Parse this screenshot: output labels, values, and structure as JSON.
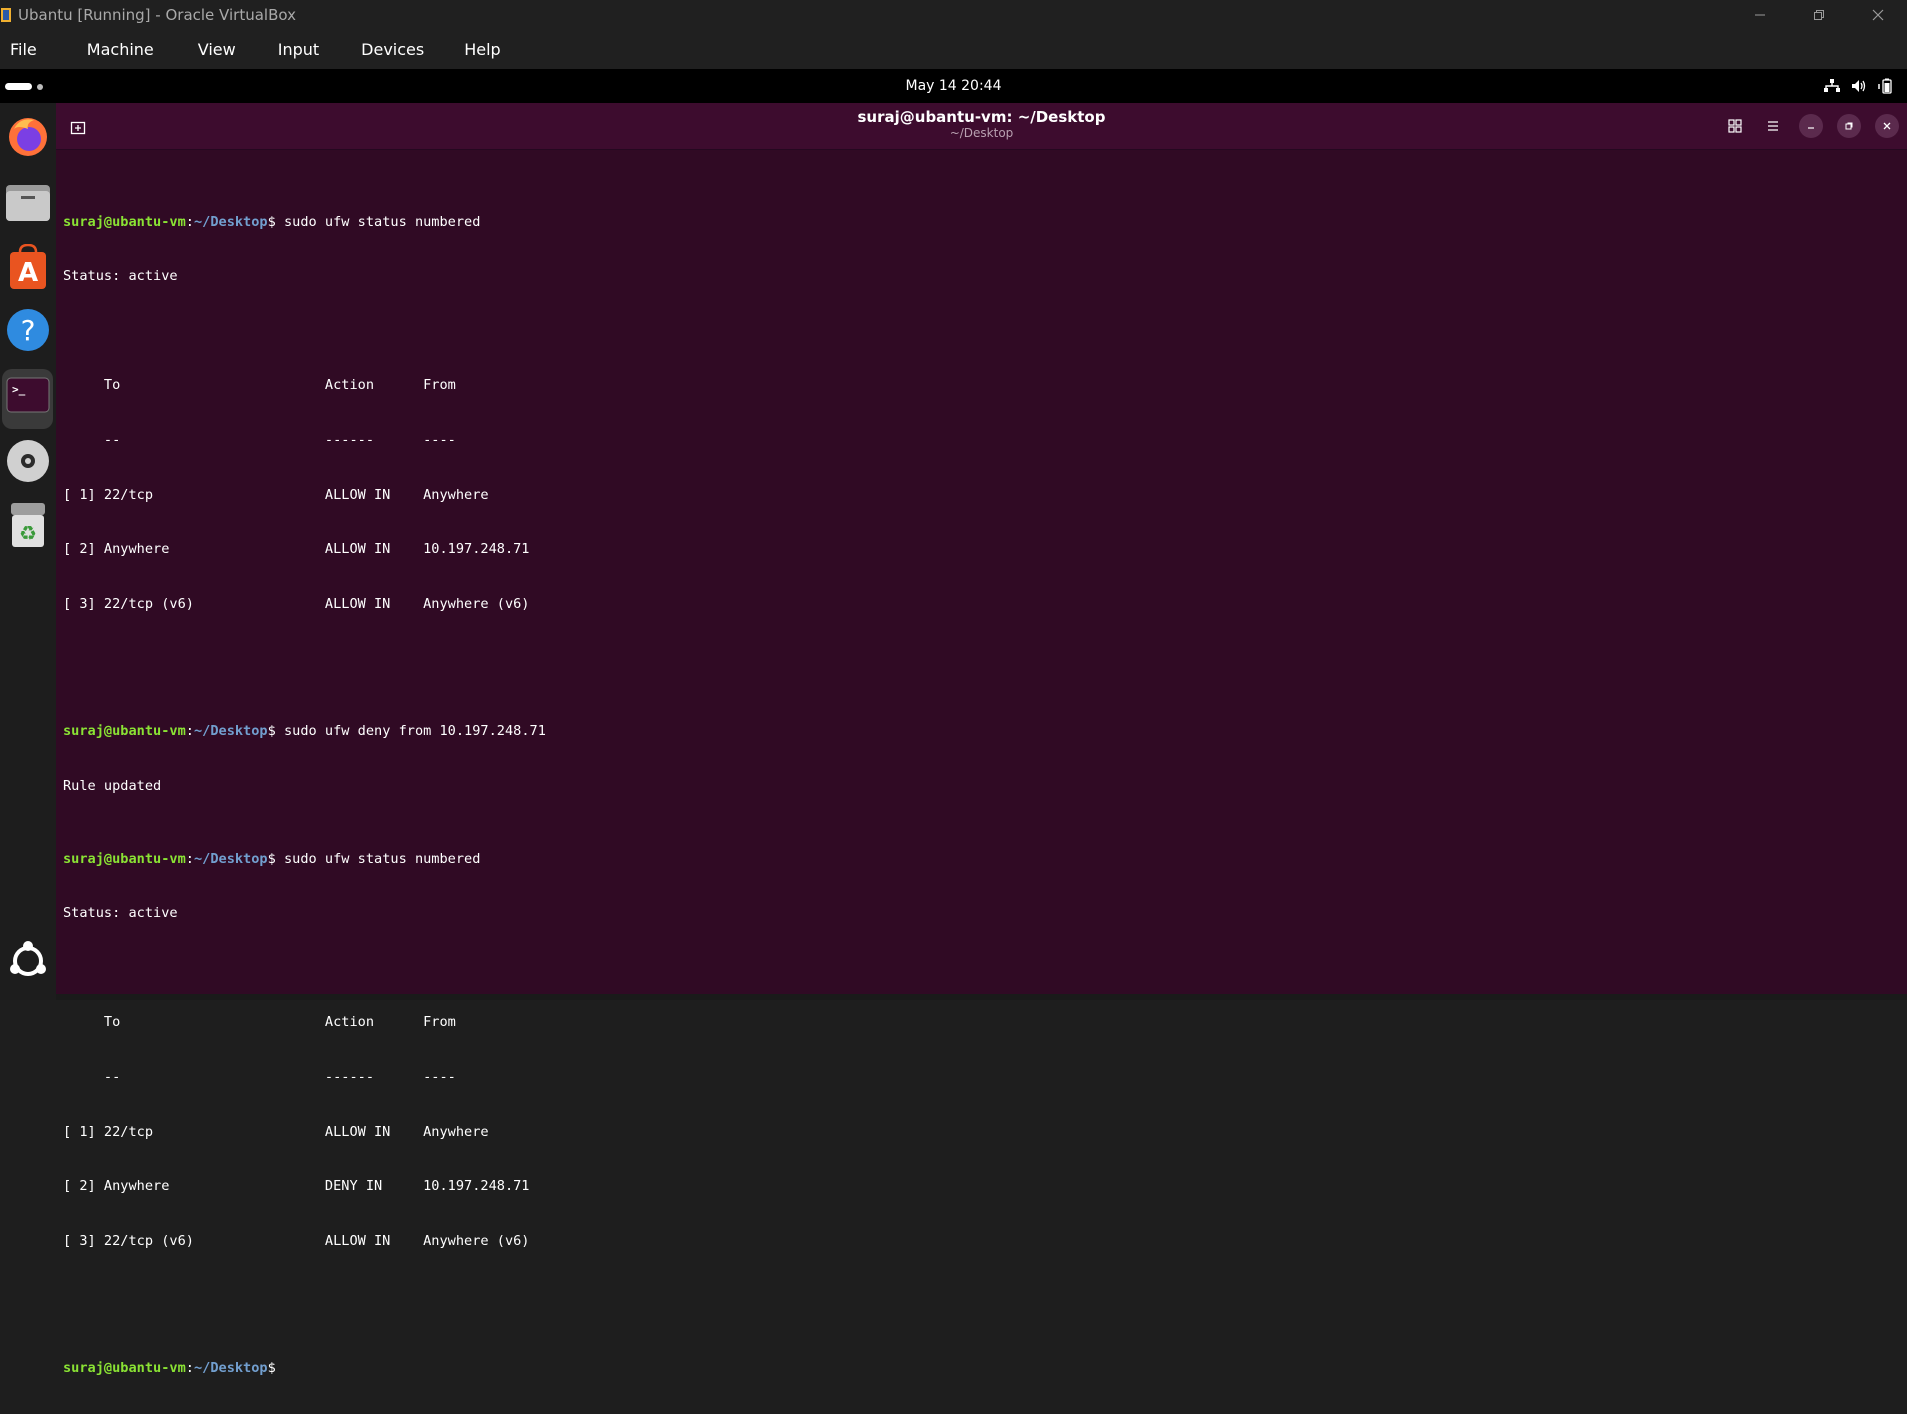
{
  "host_window": {
    "title": "Ubantu [Running] - Oracle VirtualBox",
    "menu": [
      "File",
      "Machine",
      "View",
      "Input",
      "Devices",
      "Help"
    ]
  },
  "topbar": {
    "clock": "May 14  20:44"
  },
  "dock": {
    "items": [
      {
        "name": "firefox-icon"
      },
      {
        "name": "files-icon"
      },
      {
        "name": "app-center-icon"
      },
      {
        "name": "help-icon"
      },
      {
        "name": "terminal-icon"
      },
      {
        "name": "disc-icon"
      },
      {
        "name": "trash-icon"
      },
      {
        "name": "show-apps-icon"
      }
    ]
  },
  "terminal": {
    "title": "suraj@ubantu-vm: ~/Desktop",
    "subtitle": "~/Desktop",
    "prompt": {
      "user": "suraj@ubantu-vm",
      "colon": ":",
      "path": "~/Desktop",
      "dollar": "$"
    },
    "commands": [
      " sudo ufw status numbered",
      " sudo ufw deny from 10.197.248.71",
      " sudo ufw status numbered"
    ],
    "output1": [
      "Status: active",
      "",
      "     To                         Action      From",
      "     --                         ------      ----",
      "[ 1] 22/tcp                     ALLOW IN    Anywhere",
      "[ 2] Anywhere                   ALLOW IN    10.197.248.71",
      "[ 3] 22/tcp (v6)                ALLOW IN    Anywhere (v6)",
      ""
    ],
    "output2": [
      "Rule updated"
    ],
    "output3": [
      "Status: active",
      "",
      "     To                         Action      From",
      "     --                         ------      ----",
      "[ 1] 22/tcp                     ALLOW IN    Anywhere",
      "[ 2] Anywhere                   DENY IN     10.197.248.71",
      "[ 3] 22/tcp (v6)                ALLOW IN    Anywhere (v6)",
      ""
    ]
  }
}
